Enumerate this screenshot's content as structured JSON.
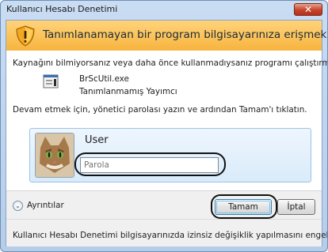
{
  "window": {
    "title": "Kullanıcı Hesabı Denetimi",
    "close_label": "✕"
  },
  "banner": {
    "heading": "Tanımlanamayan bir program bilgisayarınıza erişmek istiyor"
  },
  "body": {
    "intro": "Kaynağını bilmiyorsanız veya daha önce kullanmadıysanız programı çalıştırmayın.",
    "program_name": "BrScUtil.exe",
    "publisher": "Tanımlanmamış Yayımcı",
    "instruction": "Devam etmek için, yönetici parolası yazın ve ardından Tamam'ı tıklatın."
  },
  "credentials": {
    "username": "User",
    "password_placeholder": "Parola"
  },
  "buttons": {
    "details_label": "Ayrıntılar",
    "ok_label": "Tamam",
    "cancel_label": "İptal"
  },
  "footer": {
    "text": "Kullanıcı Hesabı Denetimi bilgisayarınızda izinsiz değişiklik yapılmasını engeller."
  },
  "icons": {
    "shield": "shield-warning-icon",
    "program": "program-icon",
    "details": "chevron-down-icon",
    "avatar": "user-avatar-cat"
  },
  "colors": {
    "banner": "#f7b43e",
    "title_close": "#c6432a",
    "ok_focus": "#3c7fb1"
  }
}
